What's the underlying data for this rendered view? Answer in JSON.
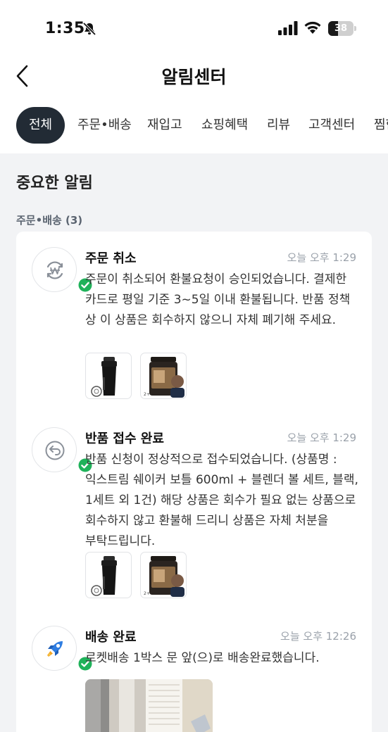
{
  "status_bar": {
    "time": "1:35",
    "battery_level": "38",
    "battery_fraction": 0.38
  },
  "header": {
    "title": "알림센터",
    "back_icon": "chevron-left-icon"
  },
  "tabs": [
    {
      "label": "전체",
      "active": true
    },
    {
      "label": "주문•배송",
      "active": false
    },
    {
      "label": "재입고",
      "active": false
    },
    {
      "label": "쇼핑혜택",
      "active": false
    },
    {
      "label": "리뷰",
      "active": false
    },
    {
      "label": "고객센터",
      "active": false
    },
    {
      "label": "찜한",
      "active": false
    }
  ],
  "section": {
    "title": "중요한 알림",
    "group_label": "주문•배송 (3)"
  },
  "notifications": [
    {
      "icon": "refund-won-icon",
      "title": "주문 취소",
      "time": "오늘 오후 1:29",
      "body": "주문이 취소되어 환불요청이 승인되었습니다. 결제한 카드로 평일 기준 3~5일 이내 환불됩니다. 반품 정책 상 이 상품은 회수하지 않으니 자체 폐기해 주세요.",
      "thumbnails": [
        "shaker-bottle-image",
        "protein-tub-image"
      ]
    },
    {
      "icon": "return-arrow-icon",
      "title": "반품 접수 완료",
      "time": "오늘 오후 1:29",
      "body": "반품 신청이 정상적으로 접수되었습니다. (상품명 : 익스트림 쉐이커 보틀 600ml + 블렌더 볼 세트, 블랙, 1세트 외 1건) 해당 상품은 회수가 필요 없는 상품으로 회수하지 않고 환불해 드리니 상품은 자체 처분을 부탁드립니다.",
      "thumbnails": [
        "shaker-bottle-image",
        "protein-tub-image"
      ]
    },
    {
      "icon": "rocket-icon",
      "title": "배송 완료",
      "time": "오늘 오후 12:26",
      "body": "로켓배송 1박스 문 앞(으)로 배송완료했습니다.",
      "thumbnails": [
        "delivery-photo"
      ]
    }
  ],
  "colors": {
    "active_tab_bg": "#222b35",
    "check_green": "#1fb25a",
    "rocket_blue": "#2f7de1"
  }
}
